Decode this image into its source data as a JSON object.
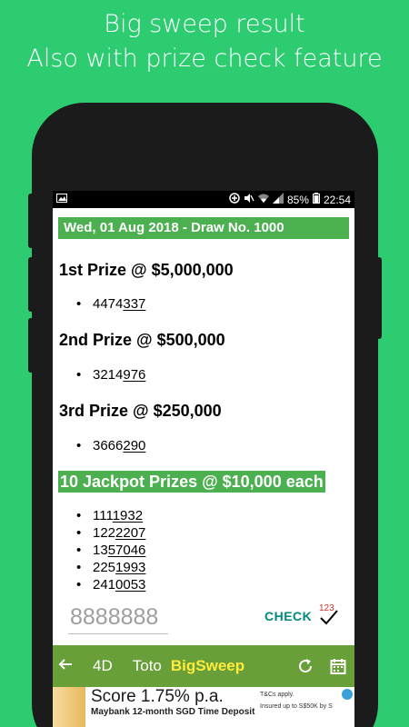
{
  "promo": {
    "line1": "Big sweep result",
    "line2": "Also with prize check feature"
  },
  "status": {
    "battery": "85%",
    "time": "22:54"
  },
  "draw": {
    "banner": "Wed, 01 Aug 2018 - Draw No. 1000"
  },
  "prizes": [
    {
      "title": "1st Prize @ $5,000,000",
      "numbers": [
        {
          "plain": "4474",
          "underlined": "337"
        }
      ]
    },
    {
      "title": "2nd Prize @ $500,000",
      "numbers": [
        {
          "plain": "3214",
          "underlined": "976"
        }
      ]
    },
    {
      "title": "3rd Prize @ $250,000",
      "numbers": [
        {
          "plain": "3666",
          "underlined": "290"
        }
      ]
    }
  ],
  "jackpot": {
    "title": "10 Jackpot Prizes @ $10,000 each",
    "numbers": [
      {
        "plain": "111",
        "underlined": "1932"
      },
      {
        "plain": "122",
        "underlined": "2207"
      },
      {
        "plain": "13",
        "underlined": "57046"
      },
      {
        "plain": "225",
        "underlined": "1993"
      },
      {
        "plain": "241",
        "underlined": "0053"
      }
    ]
  },
  "check": {
    "placeholder": "8888888",
    "button_label": "CHECK",
    "icon_label": "123"
  },
  "nav": {
    "tabs": [
      {
        "label": "4D",
        "active": false
      },
      {
        "label": "Toto",
        "active": false
      },
      {
        "label": "BigSweep",
        "active": true
      }
    ]
  },
  "ad": {
    "title": "Score 1.75% p.a.",
    "subtitle": "Maybank 12-month SGD Time Deposit",
    "side1": "T&Cs apply.",
    "side2": "Insured up to S$50K by S"
  },
  "colors": {
    "background": "#2ecc71",
    "banner_green": "#4caf50",
    "appbar": "#689f38",
    "active_tab": "#ffeb3b",
    "check_teal": "#00897b"
  }
}
